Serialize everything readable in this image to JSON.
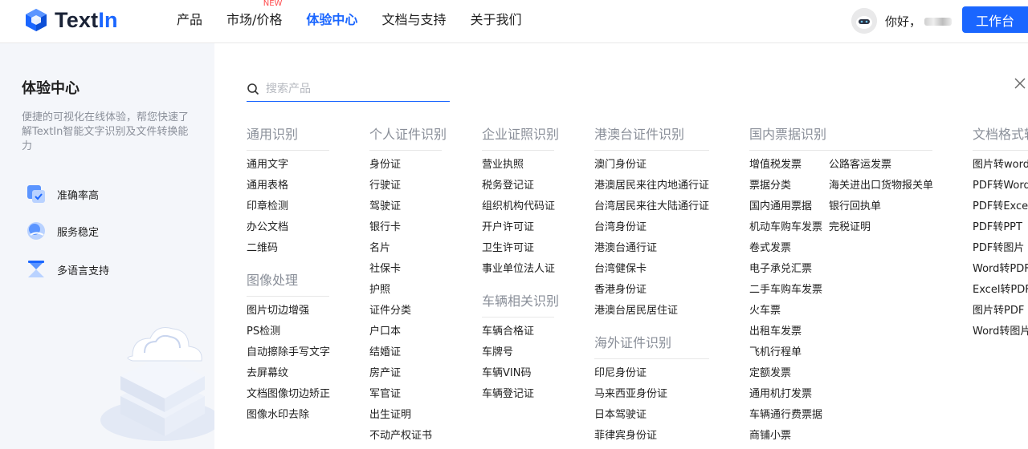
{
  "header": {
    "logo_text_main": "Text",
    "logo_text_accent": "In",
    "nav": [
      {
        "label": "产品"
      },
      {
        "label": "市场/价格",
        "badge": "NEW"
      },
      {
        "label": "体验中心"
      },
      {
        "label": "文档与支持"
      },
      {
        "label": "关于我们"
      }
    ],
    "greeting": "你好，",
    "workbench": "工作台"
  },
  "sidebar": {
    "title": "体验中心",
    "description": "便捷的可视化在线体验，帮您快速了解TextIn智能文字识别及文件转换能力",
    "features": [
      {
        "icon": "accuracy-icon",
        "label": "准确率高"
      },
      {
        "icon": "stability-icon",
        "label": "服务稳定"
      },
      {
        "icon": "language-icon",
        "label": "多语言支持"
      }
    ]
  },
  "search": {
    "placeholder": "搜索产品"
  },
  "categories": {
    "general": {
      "title": "通用识别",
      "items": [
        "通用文字",
        "通用表格",
        "印章检测",
        "办公文档",
        "二维码"
      ]
    },
    "image": {
      "title": "图像处理",
      "items": [
        "图片切边增强",
        "PS检测",
        "自动擦除手写文字",
        "去屏幕纹",
        "文档图像切边矫正",
        "图像水印去除"
      ]
    },
    "personal": {
      "title": "个人证件识别",
      "items": [
        "身份证",
        "行驶证",
        "驾驶证",
        "银行卡",
        "名片",
        "社保卡",
        "护照",
        "证件分类",
        "户口本",
        "结婚证",
        "房产证",
        "军官证",
        "出生证明",
        "不动产权证书"
      ]
    },
    "enterprise": {
      "title": "企业证照识别",
      "items": [
        "营业执照",
        "税务登记证",
        "组织机构代码证",
        "开户许可证",
        "卫生许可证",
        "事业单位法人证"
      ]
    },
    "vehicle": {
      "title": "车辆相关识别",
      "items": [
        "车辆合格证",
        "车牌号",
        "车辆VIN码",
        "车辆登记证"
      ]
    },
    "hkmt": {
      "title": "港澳台证件识别",
      "items": [
        "澳门身份证",
        "港澳居民来往内地通行证",
        "台湾居民来往大陆通行证",
        "台湾身份证",
        "港澳台通行证",
        "台湾健保卡",
        "香港身份证",
        "港澳台居民居住证"
      ]
    },
    "overseas": {
      "title": "海外证件识别",
      "items": [
        "印尼身份证",
        "马来西亚身份证",
        "日本驾驶证",
        "菲律宾身份证"
      ]
    },
    "invoice": {
      "title": "国内票据识别",
      "items": [
        "增值税发票",
        "票据分类",
        "国内通用票据",
        "机动车购车发票",
        "卷式发票",
        "电子承兑汇票",
        "二手车购车发票",
        "火车票",
        "出租车发票",
        "飞机行程单",
        "定额发票",
        "通用机打发票",
        "车辆通行费票据",
        "商铺小票"
      ],
      "items2": [
        "公路客运发票",
        "海关进出口货物报关单",
        "银行回执单",
        "完税证明"
      ]
    },
    "docconv": {
      "title": "文档格式转",
      "items": [
        "图片转word",
        "PDF转Word",
        "PDF转Excel",
        "PDF转PPT",
        "PDF转图片",
        "Word转PDF",
        "Excel转PDF",
        "图片转PDF",
        "Word转图片"
      ]
    }
  },
  "colors": {
    "accent": "#1a66ff",
    "sidebar_bg": "#f4f6fa",
    "badge": "#ff4d4f"
  }
}
